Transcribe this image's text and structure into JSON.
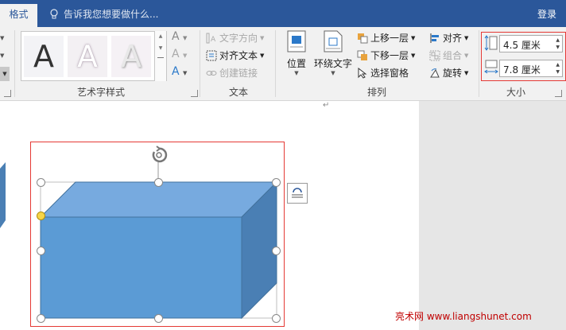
{
  "titlebar": {
    "active_tab": "格式",
    "tellme_placeholder": "告诉我您想要做什么...",
    "login": "登录"
  },
  "ribbon": {
    "wordart": {
      "label": "艺术字样式",
      "sample_letter": "A"
    },
    "text": {
      "label": "文本",
      "direction": "文字方向",
      "align": "对齐文本",
      "link": "创建链接"
    },
    "arrange": {
      "label": "排列",
      "position": "位置",
      "wrap": "环绕文字",
      "bring_forward": "上移一层",
      "send_backward": "下移一层",
      "selection_pane": "选择窗格",
      "align": "对齐",
      "group": "组合",
      "rotate": "旋转"
    },
    "size": {
      "label": "大小",
      "height": "4.5 厘米",
      "width": "7.8 厘米"
    }
  },
  "watermark": "亮术网 www.liangshunet.com",
  "colors": {
    "ribbon_blue": "#2b579a",
    "cube_front": "#5b9bd5",
    "cube_top": "#77aadf",
    "cube_side": "#4a7fb4",
    "highlight_red": "#e53935"
  }
}
